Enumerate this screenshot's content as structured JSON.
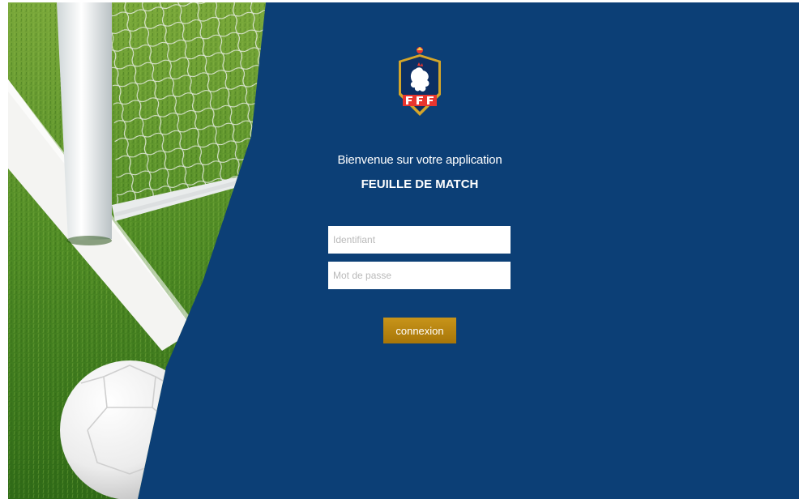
{
  "background": {
    "panel_color": "#0c3f76",
    "image": "football-goal-and-ball-on-grass"
  },
  "logo": {
    "icon": "fff-rooster-crest-icon",
    "lettering": "FFF"
  },
  "header": {
    "welcome": "Bienvenue sur votre application",
    "app_name": "FEUILLE DE MATCH"
  },
  "form": {
    "login_placeholder": "Identifiant",
    "login_value": "",
    "password_placeholder": "Mot de passe",
    "password_value": "",
    "submit_label": "connexion",
    "submit_color": "#b8860b"
  }
}
